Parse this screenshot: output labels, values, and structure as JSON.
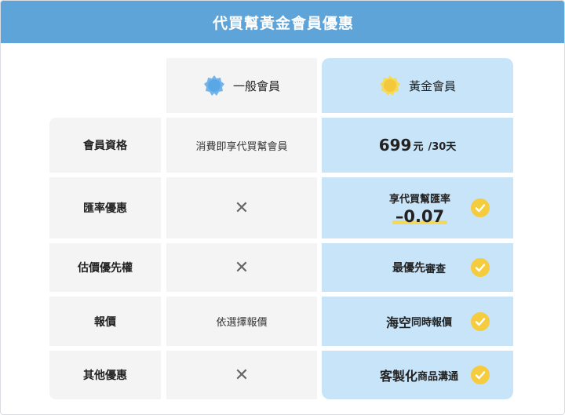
{
  "header": {
    "title": "代買幫黃金會員優惠"
  },
  "tiers": {
    "regular": {
      "label": "一般會員",
      "icon": "blue-badge-icon"
    },
    "gold": {
      "label": "黃金會員",
      "icon": "gold-badge-icon"
    }
  },
  "rows": {
    "membership": {
      "label": "會員資格",
      "regular": "消費即享代買幫會員",
      "gold_price": "699",
      "gold_unit": "元",
      "gold_per": "/30天"
    },
    "exchange": {
      "label": "匯率優惠",
      "regular_icon": "x-icon",
      "gold_label": "享代買幫匯率",
      "gold_value": "–0.07"
    },
    "estimate": {
      "label": "估價優先權",
      "regular_icon": "x-icon",
      "gold_big": "最優先",
      "gold_small": "審查"
    },
    "quote": {
      "label": "報價",
      "regular": "依選擇報價",
      "gold_big": "海空",
      "gold_small": "同時報價"
    },
    "other": {
      "label": "其他優惠",
      "regular_icon": "x-icon",
      "gold_big": "客製化",
      "gold_small": "商品溝通"
    }
  },
  "colors": {
    "header": "#5ea4d9",
    "gold_column": "#c8e4f8",
    "grey_cell": "#f4f4f4",
    "check": "#f4cc3e"
  }
}
